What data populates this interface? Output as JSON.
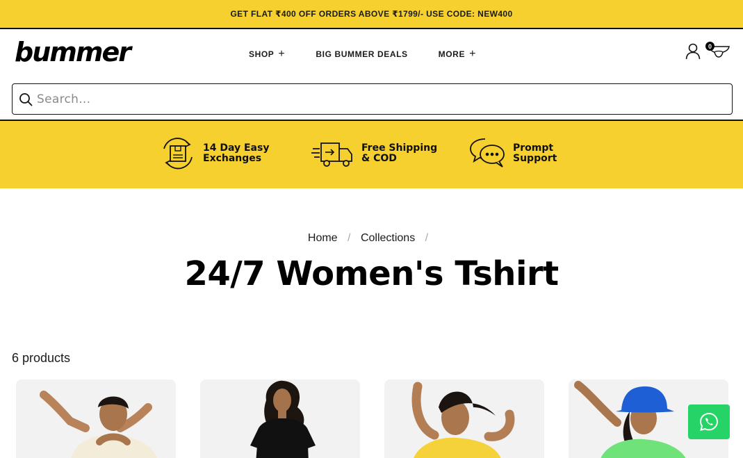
{
  "announcement": {
    "text": "GET FLAT ₹400 OFF ORDERS ABOVE ₹1799/- USE CODE: NEW400"
  },
  "header": {
    "logo": "bummer",
    "nav": [
      {
        "label": "SHOP",
        "has_plus": true
      },
      {
        "label": "BIG BUMMER DEALS",
        "has_plus": false
      },
      {
        "label": "MORE",
        "has_plus": true
      }
    ],
    "cart_count": "0",
    "icons": {
      "account": "user-icon",
      "cart": "cart-icon"
    }
  },
  "search": {
    "placeholder": "Search...",
    "value": ""
  },
  "usp": [
    {
      "icon": "exchange-box-icon",
      "text": "14 Day Easy\nExchanges"
    },
    {
      "icon": "delivery-truck-icon",
      "text": "Free Shipping\n& COD"
    },
    {
      "icon": "chat-bubbles-icon",
      "text": "Prompt\nSupport"
    }
  ],
  "breadcrumb": {
    "home": "Home",
    "collections": "Collections",
    "separator": "/"
  },
  "page_title": "24/7 Women's Tshirt",
  "product_count": "6 products",
  "products": [
    {
      "shirt_color": "#f3ecd9",
      "hat": false
    },
    {
      "shirt_color": "#111111",
      "hat": false
    },
    {
      "shirt_color": "#f5d23a",
      "hat": false
    },
    {
      "shirt_color": "#6fe27a",
      "hat": true,
      "hat_color": "#1e5fd6"
    }
  ],
  "colors": {
    "accent_yellow": "#f6d02f",
    "whatsapp_green": "#25d366"
  }
}
